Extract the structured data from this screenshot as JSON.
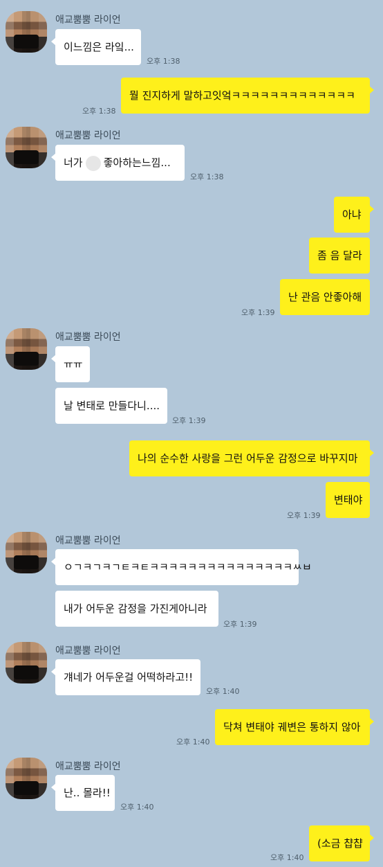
{
  "sender_name": "애교뿜뿜 라이언",
  "colors": {
    "background": "#b2c7d9",
    "incoming": "#ffffff",
    "outgoing": "#fef01b"
  },
  "messages": [
    {
      "text": "이느낌은 라잌...",
      "time": "오후 1:38"
    },
    {
      "text": "뭘 진지하게 말하고잇엌ㅋㅋㅋㅋㅋㅋㅋㅋㅋㅋㅋㅋㅋ",
      "time": "오후 1:38"
    },
    {
      "text_before": "너가",
      "text_after": "좋아하는느낌...",
      "time": "오후 1:38"
    },
    {
      "text": "아냐"
    },
    {
      "text": "좀 음 달라"
    },
    {
      "text": "난 관음 안좋아해",
      "time": "오후 1:39"
    },
    {
      "text": "ㅠㅠ"
    },
    {
      "text": "날 변태로 만들다니....",
      "time": "오후 1:39"
    },
    {
      "text": "나의 순수한 사랑을 그런 어두운 감정으로 바꾸지마"
    },
    {
      "text": "변태야",
      "time": "오후 1:39"
    },
    {
      "text": "ㅇㄱㅋㄱㅋㄱㅌㅋㅌㅋㅋㅋㅋㅋㅋㅋㅋㅋㅋㅋㅋㅋㅋㅋㅆㅂ"
    },
    {
      "text": "내가 어두운 감정을 가진게아니라",
      "time": "오후 1:39"
    },
    {
      "text": "걔네가 어두운걸 어떡하라고!!",
      "time": "오후 1:40"
    },
    {
      "text": "닥쳐 변태야 궤변은 통하지 않아",
      "time": "오후 1:40"
    },
    {
      "text": "난.. 몰라!!",
      "time": "오후 1:40"
    },
    {
      "text": "(소금 챱챱",
      "time": "오후 1:40"
    }
  ]
}
